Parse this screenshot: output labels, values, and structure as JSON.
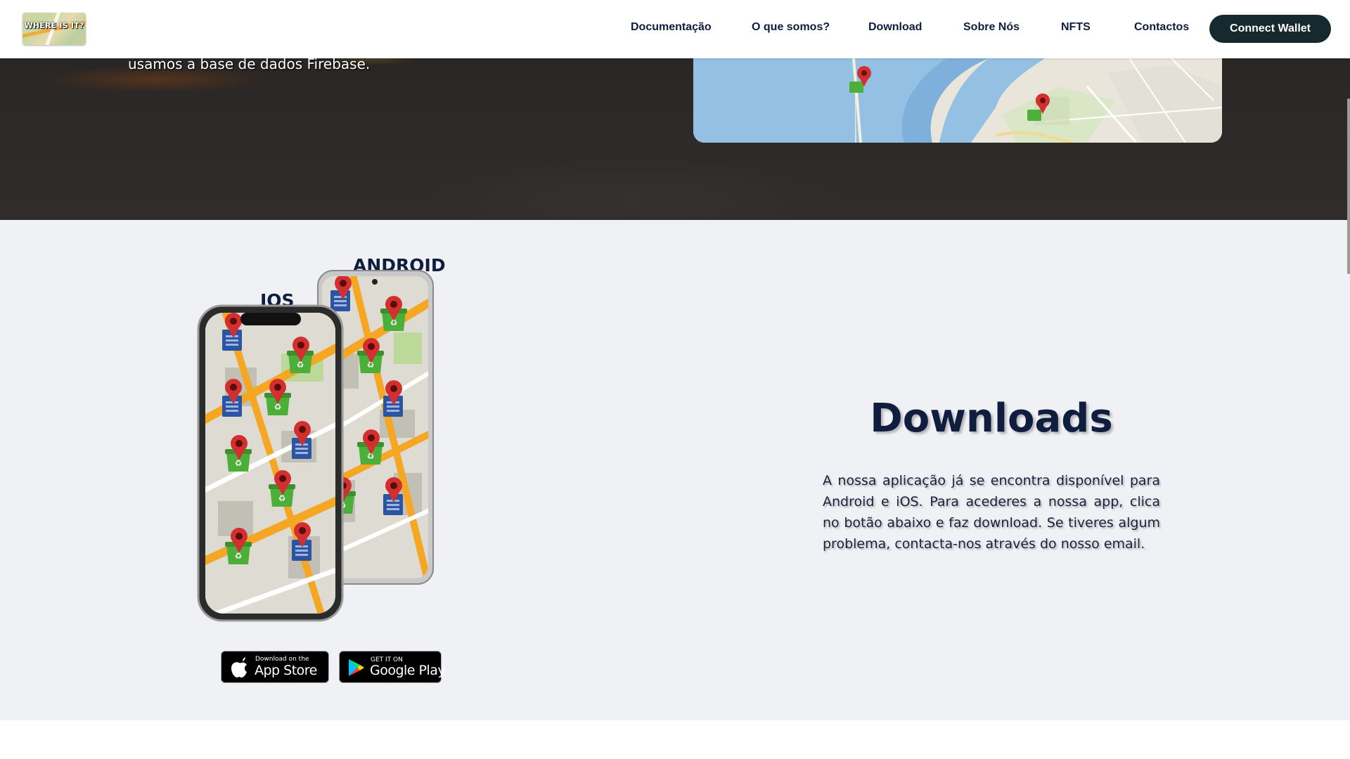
{
  "header": {
    "logo_text": "WHERE IS IT?",
    "nav": [
      {
        "label": "Documentação"
      },
      {
        "label": "O que somos?"
      },
      {
        "label": "Download"
      },
      {
        "label": "Sobre Nós"
      },
      {
        "label": "NFTS"
      },
      {
        "label": "Contactos"
      }
    ],
    "wallet_button": "Connect Wallet"
  },
  "hero": {
    "text": "usamos a base de dados Firebase."
  },
  "downloads": {
    "android_label": "ANDROID",
    "ios_label": "IOS",
    "title": "Downloads",
    "description": "A nossa aplicação já se encontra disponível para Android e iOS. Para acederes a nossa app, clica no botão abaixo e faz download. Se tiveres algum problema, contacta-nos através do nosso email.",
    "app_store": {
      "small": "Download on the",
      "big": "App Store"
    },
    "google_play": {
      "small": "GET IT ON",
      "big": "Google Play"
    }
  },
  "colors": {
    "navy": "#0f1d3f",
    "wallet_bg": "#16292e",
    "section_bg": "#f0f1f5",
    "bin_green": "#4caf3a",
    "bin_blue": "#2b55a3",
    "pin_red": "#d32f2f",
    "road_orange": "#f5a623"
  }
}
